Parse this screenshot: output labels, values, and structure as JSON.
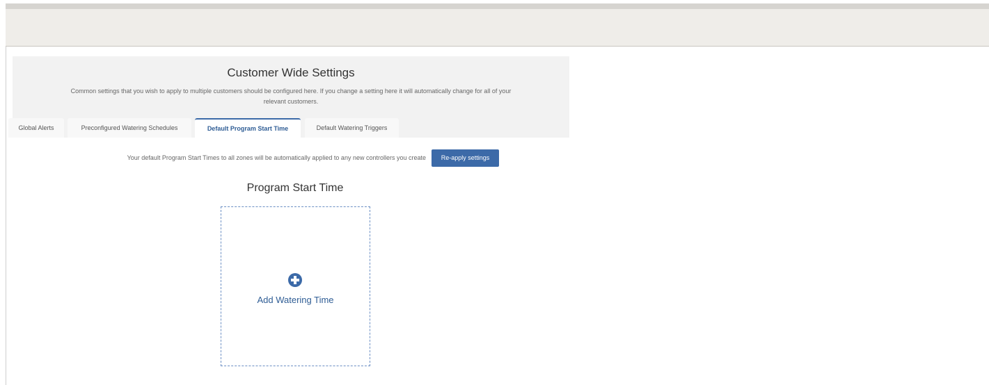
{
  "header": {
    "title": "Customer Wide Settings",
    "description": "Common settings that you wish to apply to multiple customers should be configured here. If you change a setting here it will automatically change for all of your relevant customers."
  },
  "tabs": [
    {
      "label": "Global Alerts",
      "active": false
    },
    {
      "label": "Preconfigured Watering Schedules",
      "active": false
    },
    {
      "label": "Default Program Start Time",
      "active": true
    },
    {
      "label": "Default Watering Triggers",
      "active": false
    }
  ],
  "notice": {
    "text": "Your default Program Start Times to all zones will be automatically applied to any new controllers you create",
    "button_label": "Re-apply settings"
  },
  "program": {
    "title": "Program Start Time",
    "add_label": "Add Watering Time",
    "add_icon": "plus-circle-icon"
  },
  "colors": {
    "accent": "#3c6aa8",
    "header_bg": "#f2f2f2",
    "topbar_bg": "#efede9"
  }
}
